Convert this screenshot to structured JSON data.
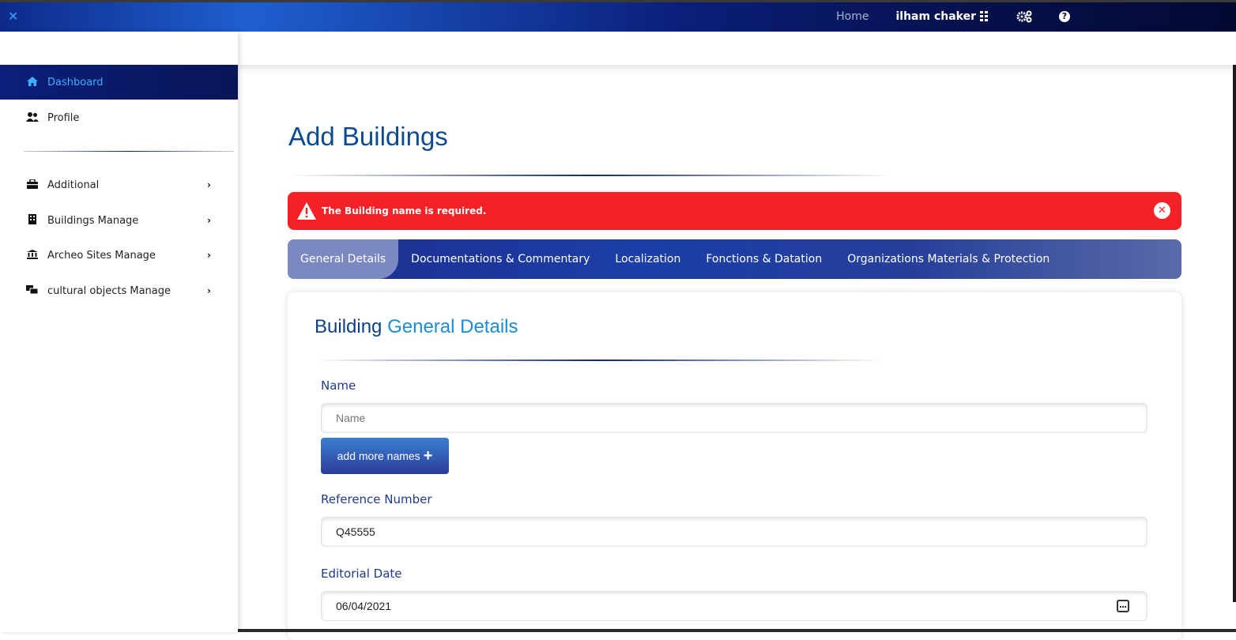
{
  "topbar": {
    "close_glyph": "✕",
    "home_label": "Home",
    "user_name": "ilham chaker",
    "user_icon": "grid-icon",
    "settings_icon": "gears-icon",
    "help_icon": "question-icon",
    "colors": {
      "bar_start": "#0d2a8a",
      "bar_end": "#020a33"
    }
  },
  "sidebar": {
    "items": [
      {
        "label": "Dashboard",
        "icon": "home-icon",
        "active": true
      },
      {
        "label": "Profile",
        "icon": "users-icon",
        "active": false
      },
      {
        "label": "Additional",
        "icon": "briefcase-icon",
        "chevron": "›"
      },
      {
        "label": "Buildings Manage",
        "icon": "building-icon",
        "chevron": "›"
      },
      {
        "label": "Archeo Sites Manage",
        "icon": "landmark-icon",
        "chevron": "›"
      },
      {
        "label": "cultural objects Manage",
        "icon": "objects-icon",
        "chevron": "›"
      }
    ]
  },
  "main": {
    "title": "Add Buildings",
    "alert": {
      "message": "The Building name is required.",
      "color": "#f42127"
    },
    "tabs": [
      {
        "label": "General Details",
        "active": true
      },
      {
        "label": "Documentations & Commentary"
      },
      {
        "label": "Localization"
      },
      {
        "label": "Fonctions & Datation"
      },
      {
        "label": "Organizations Materials & Protection"
      }
    ],
    "card": {
      "title_part1": "Building",
      "title_part2": "General Details",
      "name_label": "Name",
      "name_placeholder": "Name",
      "add_names_label": "add more names",
      "ref_label": "Reference Number",
      "ref_value": "Q45555",
      "date_label": "Editorial Date",
      "date_value": "06/04/2021"
    }
  }
}
